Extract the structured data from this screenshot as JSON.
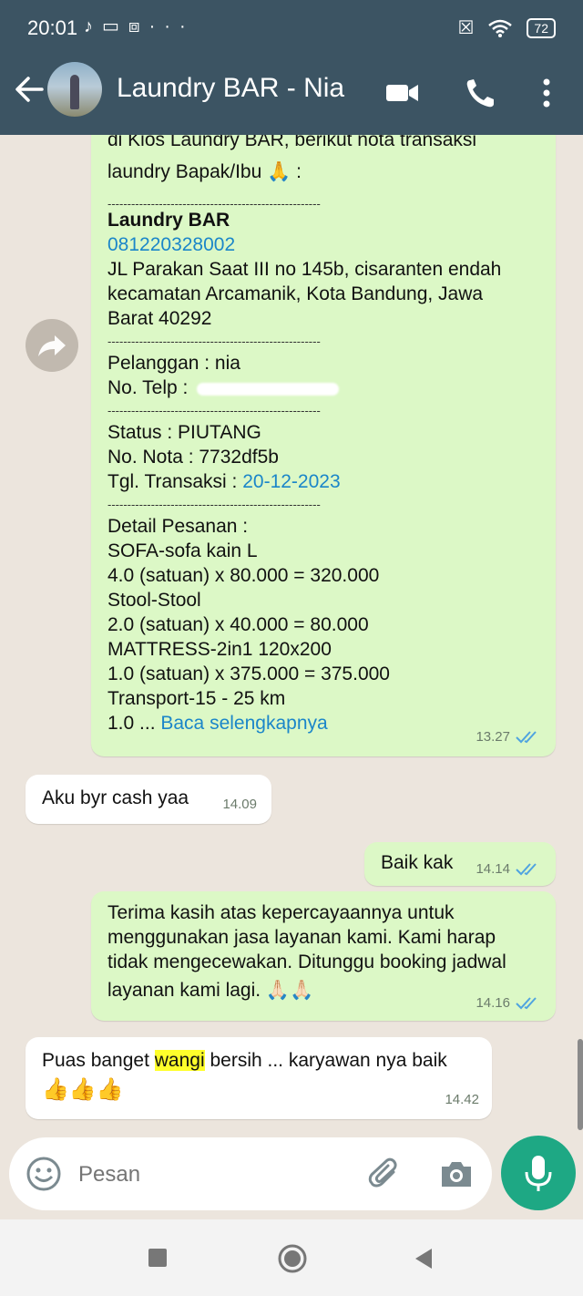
{
  "status_bar": {
    "time": "20:01",
    "left_icons": [
      "tiktok-icon",
      "laptop-icon",
      "app-icon"
    ],
    "more": "···",
    "battery": "72"
  },
  "header": {
    "contact_name": "Laundry BAR - Nia"
  },
  "messages": {
    "m1": {
      "line_partial": "di Kios Laundry BAR, berikut nota transaksi",
      "line2": "laundry Bapak/Ibu 🙏 :",
      "divider": "------------------------------------------------------",
      "store_name": "Laundry BAR",
      "phone": "081220328002",
      "address1": "JL Parakan Saat III no 145b, cisaranten endah",
      "address2": "kecamatan Arcamanik, Kota Bandung, Jawa",
      "address3": "Barat 40292",
      "customer": "Pelanggan : nia",
      "telp_label": "No. Telp :",
      "status": "Status : PIUTANG",
      "nota": "No. Nota : 7732df5b",
      "tgl_label": "Tgl. Transaksi : ",
      "tgl_value": "20-12-2023",
      "detail_title": "Detail Pesanan :",
      "item1": "SOFA-sofa kain L",
      "item1_calc": "4.0 (satuan) x 80.000 = 320.000",
      "item2": "Stool-Stool",
      "item2_calc": "2.0 (satuan) x 40.000 = 80.000",
      "item3": "MATTRESS-2in1 120x200",
      "item3_calc": "1.0 (satuan) x 375.000 = 375.000",
      "item4": "Transport-15 - 25 km",
      "item4_prefix": "1.0 ... ",
      "read_more": "Baca selengkapnya",
      "time": "13.27"
    },
    "m2": {
      "text": "Aku byr cash yaa",
      "time": "14.09"
    },
    "m3": {
      "text": "Baik kak",
      "time": "14.14"
    },
    "m4": {
      "line1": "Terima kasih atas kepercayaannya untuk",
      "line2": "menggunakan jasa layanan kami. Kami harap",
      "line3": "tidak mengecewakan. Ditunggu booking  jadwal",
      "line4": "layanan kami lagi. 🙏🏻🙏🏻",
      "time": "14.16"
    },
    "m5": {
      "before": "Puas banget ",
      "highlight": "wangi",
      "after": " bersih ... karyawan nya baik",
      "emoji": "👍👍👍",
      "time": "14.42"
    }
  },
  "composer": {
    "placeholder": "Pesan"
  },
  "colors": {
    "header_bg": "#3c5463",
    "outgoing_bubble": "#dcf8c6",
    "incoming_bubble": "#ffffff",
    "mic_button": "#1ea884",
    "link": "#1b86c9",
    "highlight": "#ffff2b"
  }
}
